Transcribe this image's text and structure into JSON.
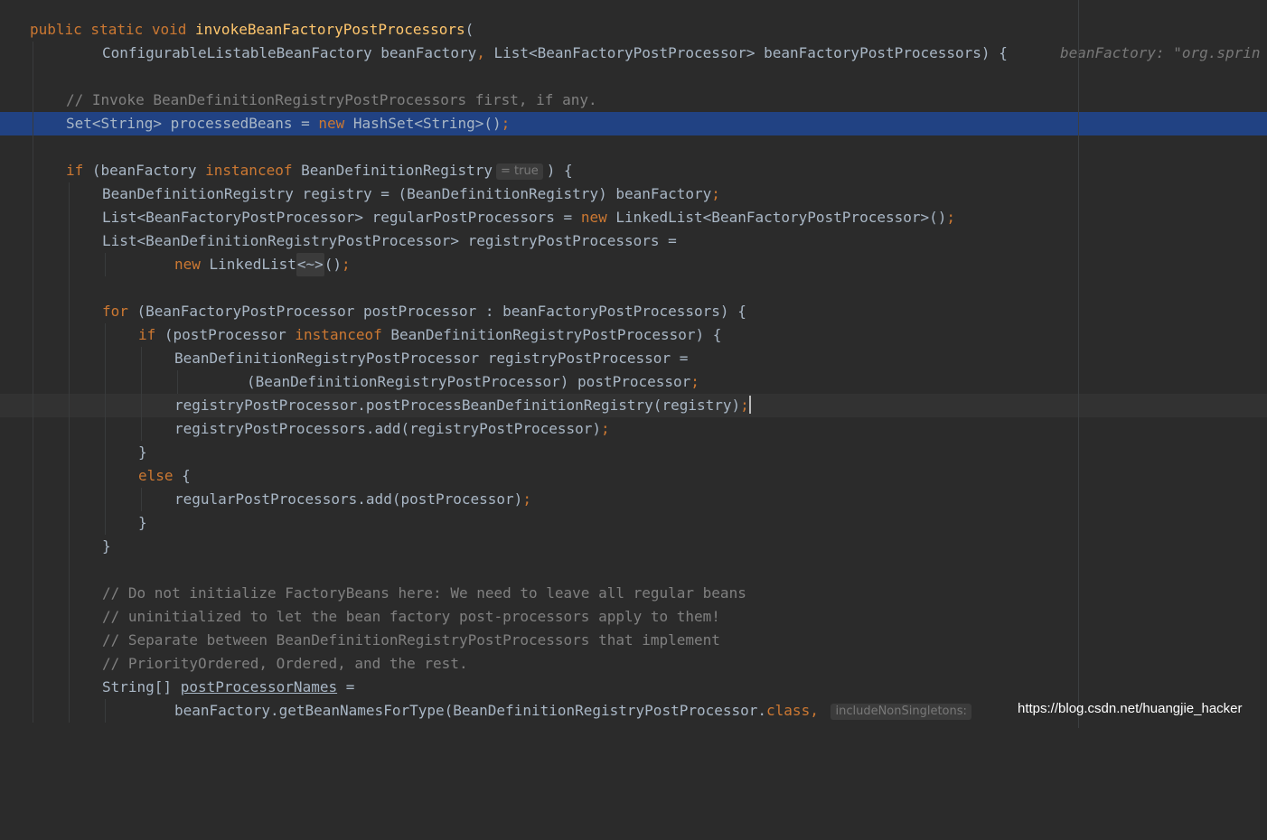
{
  "code": {
    "l1_kw": "public static void ",
    "l1_fn": "invokeBeanFactoryPostProcessors",
    "l1_rest": "(",
    "l2_a": "ConfigurableListableBeanFactory beanFactory",
    "l2_b": ", ",
    "l2_c": "List<BeanFactoryPostProcessor> beanFactoryPostProcessors) {",
    "l2_hint": "beanFactory: \"org.sprin",
    "l4_comment": "// Invoke BeanDefinitionRegistryPostProcessors first, if any.",
    "l5_a": "Set<String> processedBeans = ",
    "l5_kw": "new ",
    "l5_b": "HashSet<String>()",
    "l5_semi": ";",
    "l7_kw": "if ",
    "l7_a": "(beanFactory ",
    "l7_kw2": "instanceof ",
    "l7_b": "BeanDefinitionRegistry",
    "l7_inlay": "= true",
    "l7_c": ") {",
    "l8_a": "BeanDefinitionRegistry registry = (BeanDefinitionRegistry) beanFactory",
    "l8_semi": ";",
    "l9_a": "List<BeanFactoryPostProcessor> regularPostProcessors = ",
    "l9_kw": "new ",
    "l9_b": "LinkedList<BeanFactoryPostProcessor>()",
    "l9_semi": ";",
    "l10_a": "List<BeanDefinitionRegistryPostProcessor> registryPostProcessors =",
    "l11_kw": "new ",
    "l11_a": "LinkedList",
    "l11_fold": "<~>",
    "l11_b": "()",
    "l11_semi": ";",
    "l13_kw": "for ",
    "l13_a": "(BeanFactoryPostProcessor postProcessor : beanFactoryPostProcessors) {",
    "l14_kw": "if ",
    "l14_a": "(postProcessor ",
    "l14_kw2": "instanceof ",
    "l14_b": "BeanDefinitionRegistryPostProcessor) {",
    "l15_a": "BeanDefinitionRegistryPostProcessor registryPostProcessor =",
    "l16_a": "(BeanDefinitionRegistryPostProcessor) postProcessor",
    "l16_semi": ";",
    "l17_a": "registryPostProcessor.postProcessBeanDefinitionRegistry(registry)",
    "l17_semi": ";",
    "l18_a": "registryPostProcessors.add(registryPostProcessor)",
    "l18_semi": ";",
    "l19_a": "}",
    "l20_kw": "else ",
    "l20_a": "{",
    "l21_a": "regularPostProcessors.add(postProcessor)",
    "l21_semi": ";",
    "l22_a": "}",
    "l23_a": "}",
    "l25_comment": "// Do not initialize FactoryBeans here: We need to leave all regular beans",
    "l26_comment": "// uninitialized to let the bean factory post-processors apply to them!",
    "l27_comment": "// Separate between BeanDefinitionRegistryPostProcessors that implement",
    "l28_comment": "// PriorityOrdered, Ordered, and the rest.",
    "l29_a": "String[] ",
    "l29_b": "postProcessorNames",
    "l29_c": " =",
    "l30_a": "beanFactory.getBeanNamesForType(BeanDefinitionRegistryPostProcessor.",
    "l30_kw": "class",
    "l30_b": ", ",
    "l30_inlay": "includeNonSingletons:"
  },
  "watermark": "https://blog.csdn.net/huangjie_hacker",
  "colors": {
    "background": "#2b2b2b",
    "text": "#a9b7c6",
    "keyword": "#cc7832",
    "function": "#ffc66d",
    "comment": "#808080",
    "selection": "#214283"
  }
}
